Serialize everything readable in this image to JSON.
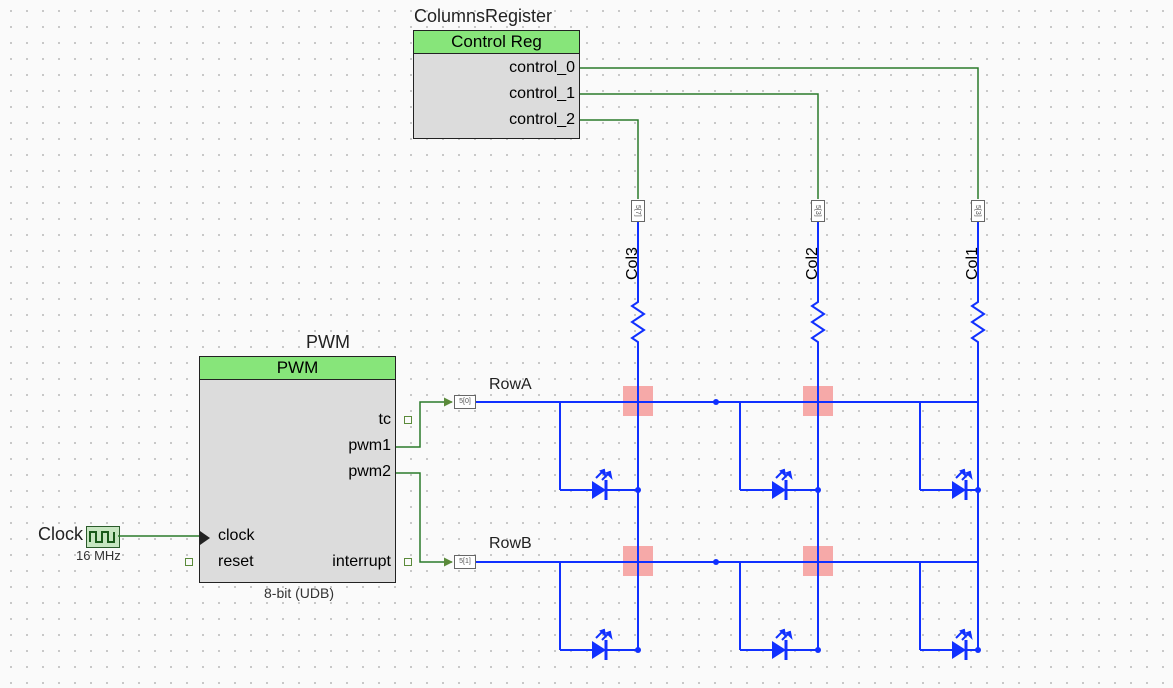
{
  "columns_register": {
    "instance": "ColumnsRegister",
    "title": "Control Reg",
    "outputs": [
      "control_0",
      "control_1",
      "control_2"
    ]
  },
  "pwm": {
    "instance": "PWM",
    "title": "PWM",
    "subtext": "8-bit (UDB)",
    "ports": {
      "tc": "tc",
      "pwm1": "pwm1",
      "pwm2": "pwm2",
      "clock": "clock",
      "reset": "reset",
      "interrupt": "interrupt"
    }
  },
  "clock": {
    "label": "Clock",
    "freq": "16 MHz"
  },
  "rows": {
    "a": "RowA",
    "b": "RowB"
  },
  "cols": {
    "c1": "Col1",
    "c2": "Col2",
    "c3": "Col3"
  },
  "pins": {
    "rowA": "5[0]",
    "rowB": "5[1]",
    "col3": "5[7]",
    "col2": "5[3]",
    "col1": "5[3]"
  },
  "led_matrix": {
    "rows": [
      "RowA",
      "RowB"
    ],
    "cols": [
      "Col3",
      "Col2",
      "Col1"
    ],
    "driver_row_signals": [
      "pwm1",
      "pwm2"
    ],
    "driver_col_signals": [
      "control_2",
      "control_1",
      "control_0"
    ]
  }
}
